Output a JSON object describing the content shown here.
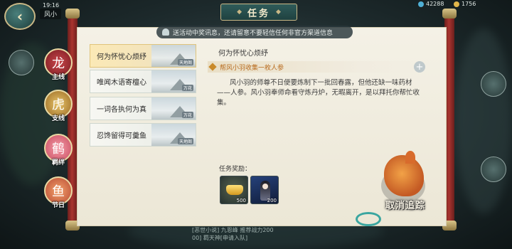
{
  "status": {
    "time": "19:16",
    "player_name": "风小",
    "resource_1": "42288",
    "resource_2": "1756"
  },
  "header": {
    "title": "任务"
  },
  "notice": {
    "text": "送活动中奖讯息，还请留意不要轻信任何非官方渠道信息"
  },
  "nav": [
    {
      "label": "主线",
      "icon": "dragon-icon"
    },
    {
      "label": "支线",
      "icon": "tiger-icon"
    },
    {
      "label": "羁绊",
      "icon": "crane-icon"
    },
    {
      "label": "节日",
      "icon": "fish-icon"
    }
  ],
  "quests": [
    {
      "name": "何为怀忧心烦纾",
      "tag": "天地阁",
      "active": true
    },
    {
      "name": "唯闻木语寄檀心",
      "tag": "万花",
      "active": false
    },
    {
      "name": "一词各执何为真",
      "tag": "万花",
      "active": false
    },
    {
      "name": "忍馋留得可羹鱼",
      "tag": "天地阁",
      "active": false
    }
  ],
  "detail": {
    "title": "何为怀忧心烦纾",
    "step": "帮风小羽收集一枚人参",
    "description": "风小羽的师尊不日便要炼制下一批回春露，但他还缺一味药材——人参。风小羽奉师命看守炼丹炉，无暇离开，是以拜托你帮忙收集。",
    "reward_label": "任务奖励：",
    "rewards": [
      {
        "icon": "gold-ingot-icon",
        "qty": "500"
      },
      {
        "icon": "character-card-icon",
        "qty": "200"
      }
    ]
  },
  "actions": {
    "cancel_tracking": "取消追踪"
  },
  "chat": {
    "line1": "[恶世小说] 九恩峰 推荐战力200",
    "line2": "00] 羁天神[申请入队]"
  },
  "colors": {
    "accent": "#b86a1c",
    "panel": "#f4f1e6",
    "rod": "#a9342f",
    "banner": "#2f5c5a"
  }
}
